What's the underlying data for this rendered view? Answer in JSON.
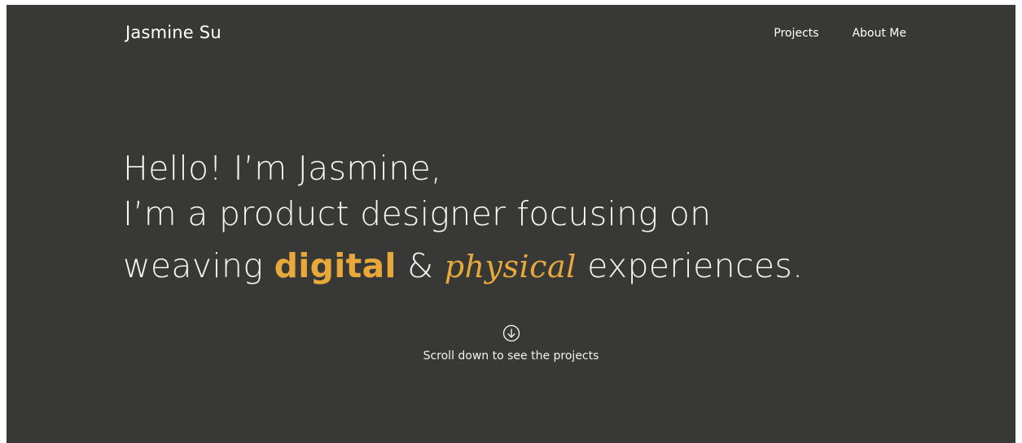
{
  "header": {
    "site_name": "Jasmine Su",
    "nav": {
      "projects": "Projects",
      "about": "About Me"
    }
  },
  "hero": {
    "line1": "Hello! I’m Jasmine,",
    "line2": "I’m a product designer focusing on",
    "line3_start": "weaving ",
    "highlight1": "digital",
    "connector": " & ",
    "highlight2": "physical",
    "line3_end": " experiences."
  },
  "scroll_cue": {
    "icon": "arrow-down-circle-icon",
    "text": "Scroll down to see the projects"
  },
  "colors": {
    "background": "#383937",
    "accent": "#e8a93a",
    "text": "#ffffff"
  }
}
